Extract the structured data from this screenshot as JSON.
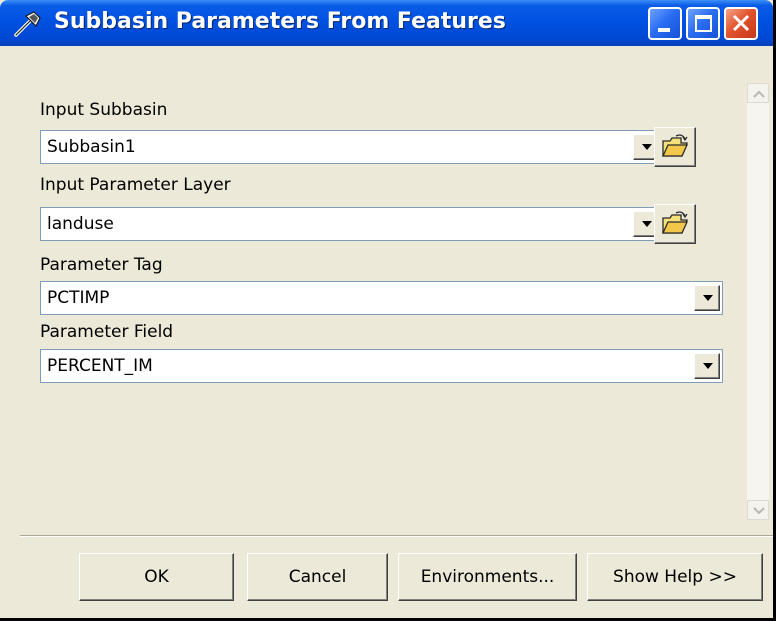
{
  "window": {
    "title": "Subbasin Parameters From Features",
    "controls": [
      "minimize-icon",
      "maximize-icon",
      "close-icon"
    ]
  },
  "fields": [
    {
      "label": "Input Subbasin",
      "value": "Subbasin1",
      "has_browse": true
    },
    {
      "label": "Input Parameter Layer",
      "value": "landuse",
      "has_browse": true
    },
    {
      "label": "Parameter Tag",
      "value": "PCTIMP",
      "has_browse": false
    },
    {
      "label": "Parameter Field",
      "value": "PERCENT_IM",
      "has_browse": false
    }
  ],
  "buttons": {
    "ok": "OK",
    "cancel": "Cancel",
    "environments": "Environments...",
    "show_help": "Show Help >>"
  },
  "colors": {
    "titlebar": "#0050e0",
    "close_button": "#e2542e",
    "dialog_background": "#ece9d8"
  }
}
